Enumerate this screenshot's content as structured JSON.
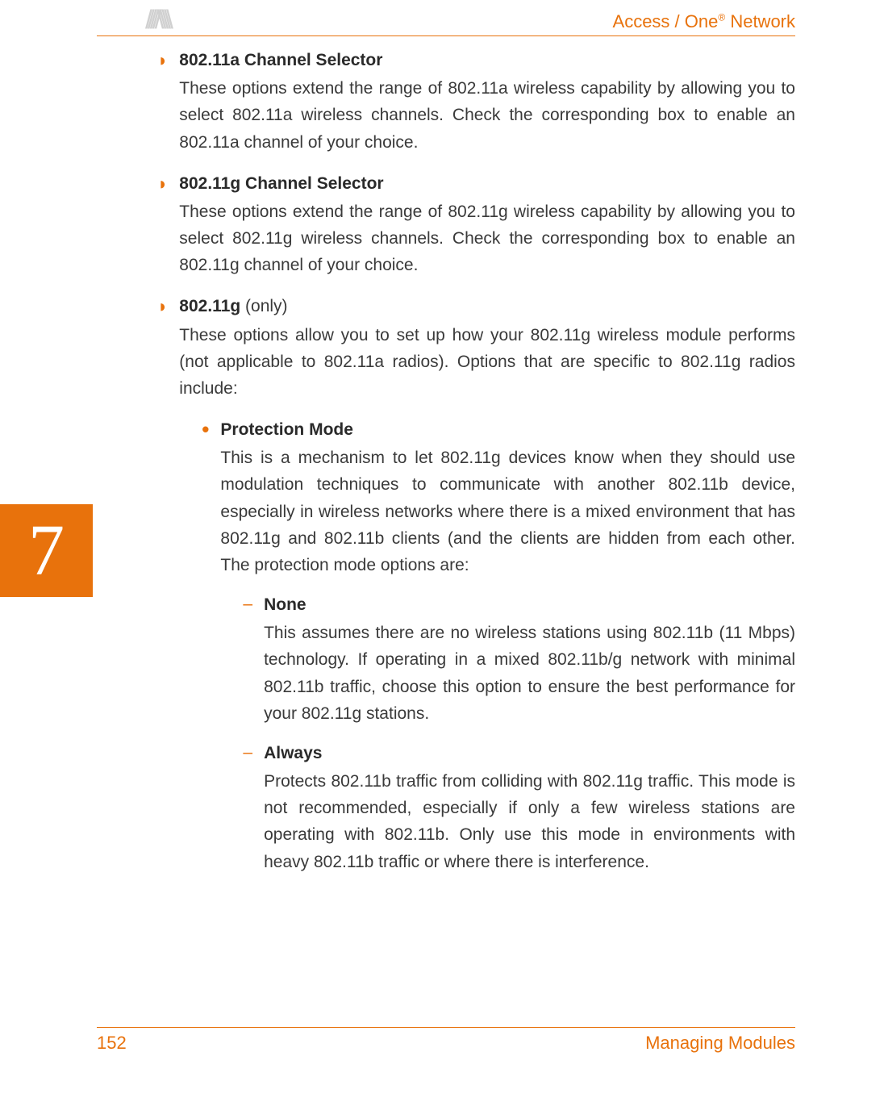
{
  "header": {
    "product_line_1": "Access / One",
    "product_sup": "®",
    "product_line_2": " Network"
  },
  "chapter": {
    "number": "7"
  },
  "content": {
    "bullets": [
      {
        "title": "802.11a Channel Selector",
        "title_extra": "",
        "desc": "These options extend the range of 802.11a wireless capability by allowing you to select 802.11a wireless channels. Check the corresponding box to enable an 802.11a channel of your choice."
      },
      {
        "title": "802.11g Channel Selector",
        "title_extra": "",
        "desc": "These options extend the range of 802.11g wireless capability by allowing you to select 802.11g wireless channels. Check the corresponding box to enable an 802.11g channel of your choice."
      },
      {
        "title": "802.11g",
        "title_extra": " (only)",
        "desc": "These options allow you to set up how your 802.11g wireless module performs (not applicable to 802.11a radios). Options that are specific to 802.11g radios include:"
      }
    ],
    "sub_bullet": {
      "title": "Protection Mode",
      "desc": "This is a mechanism to let 802.11g devices know when they should use modulation techniques to communicate with another 802.11b device, especially in wireless networks where there is a mixed environment that has 802.11g and 802.11b clients (and the clients are hidden from each other. The protection mode options are:"
    },
    "dashes": [
      {
        "title": "None",
        "desc": "This assumes there are no wireless stations using 802.11b (11 Mbps) technology. If operating in a mixed 802.11b/g network with minimal 802.11b traffic, choose this option to ensure the best performance for your 802.11g stations."
      },
      {
        "title": "Always",
        "desc": "Protects 802.11b traffic from colliding with 802.11g traffic. This mode is not recommended, especially if only a few wireless stations are operating with 802.11b. Only use this mode in environments with heavy 802.11b traffic or where there is interference."
      }
    ]
  },
  "footer": {
    "page_number": "152",
    "section": "Managing Modules"
  }
}
